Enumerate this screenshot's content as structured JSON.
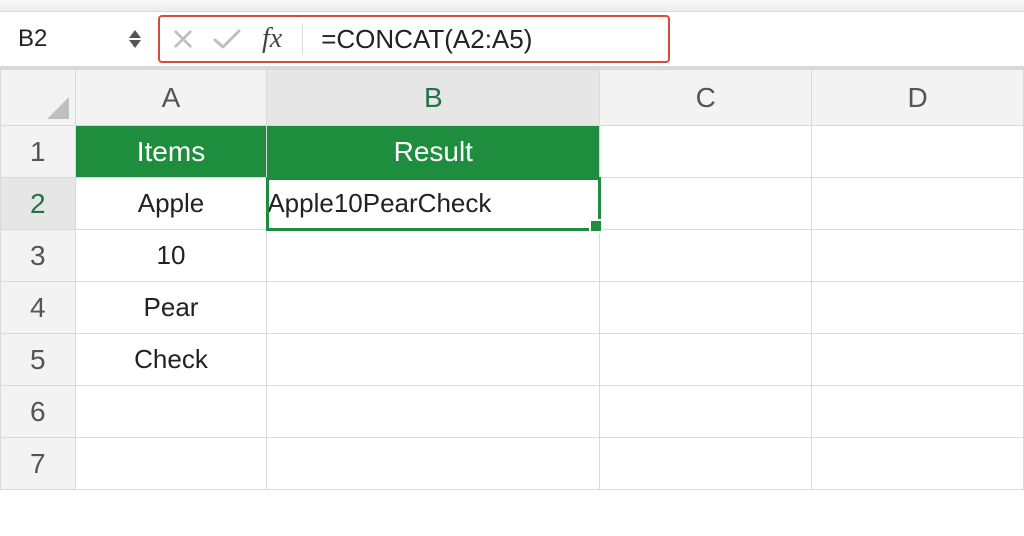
{
  "nameBox": {
    "value": "B2"
  },
  "formulaBar": {
    "fxLabel": "fx",
    "formula": "=CONCAT(A2:A5)"
  },
  "columns": {
    "A": "A",
    "B": "B",
    "C": "C",
    "D": "D"
  },
  "rowLabels": [
    "1",
    "2",
    "3",
    "4",
    "5",
    "6",
    "7"
  ],
  "headers": {
    "A": "Items",
    "B": "Result"
  },
  "cells": {
    "A2": "Apple",
    "A3": "10",
    "A4": "Pear",
    "A5": "Check",
    "B2": "Apple10PearCheck"
  },
  "selectedCell": "B2"
}
